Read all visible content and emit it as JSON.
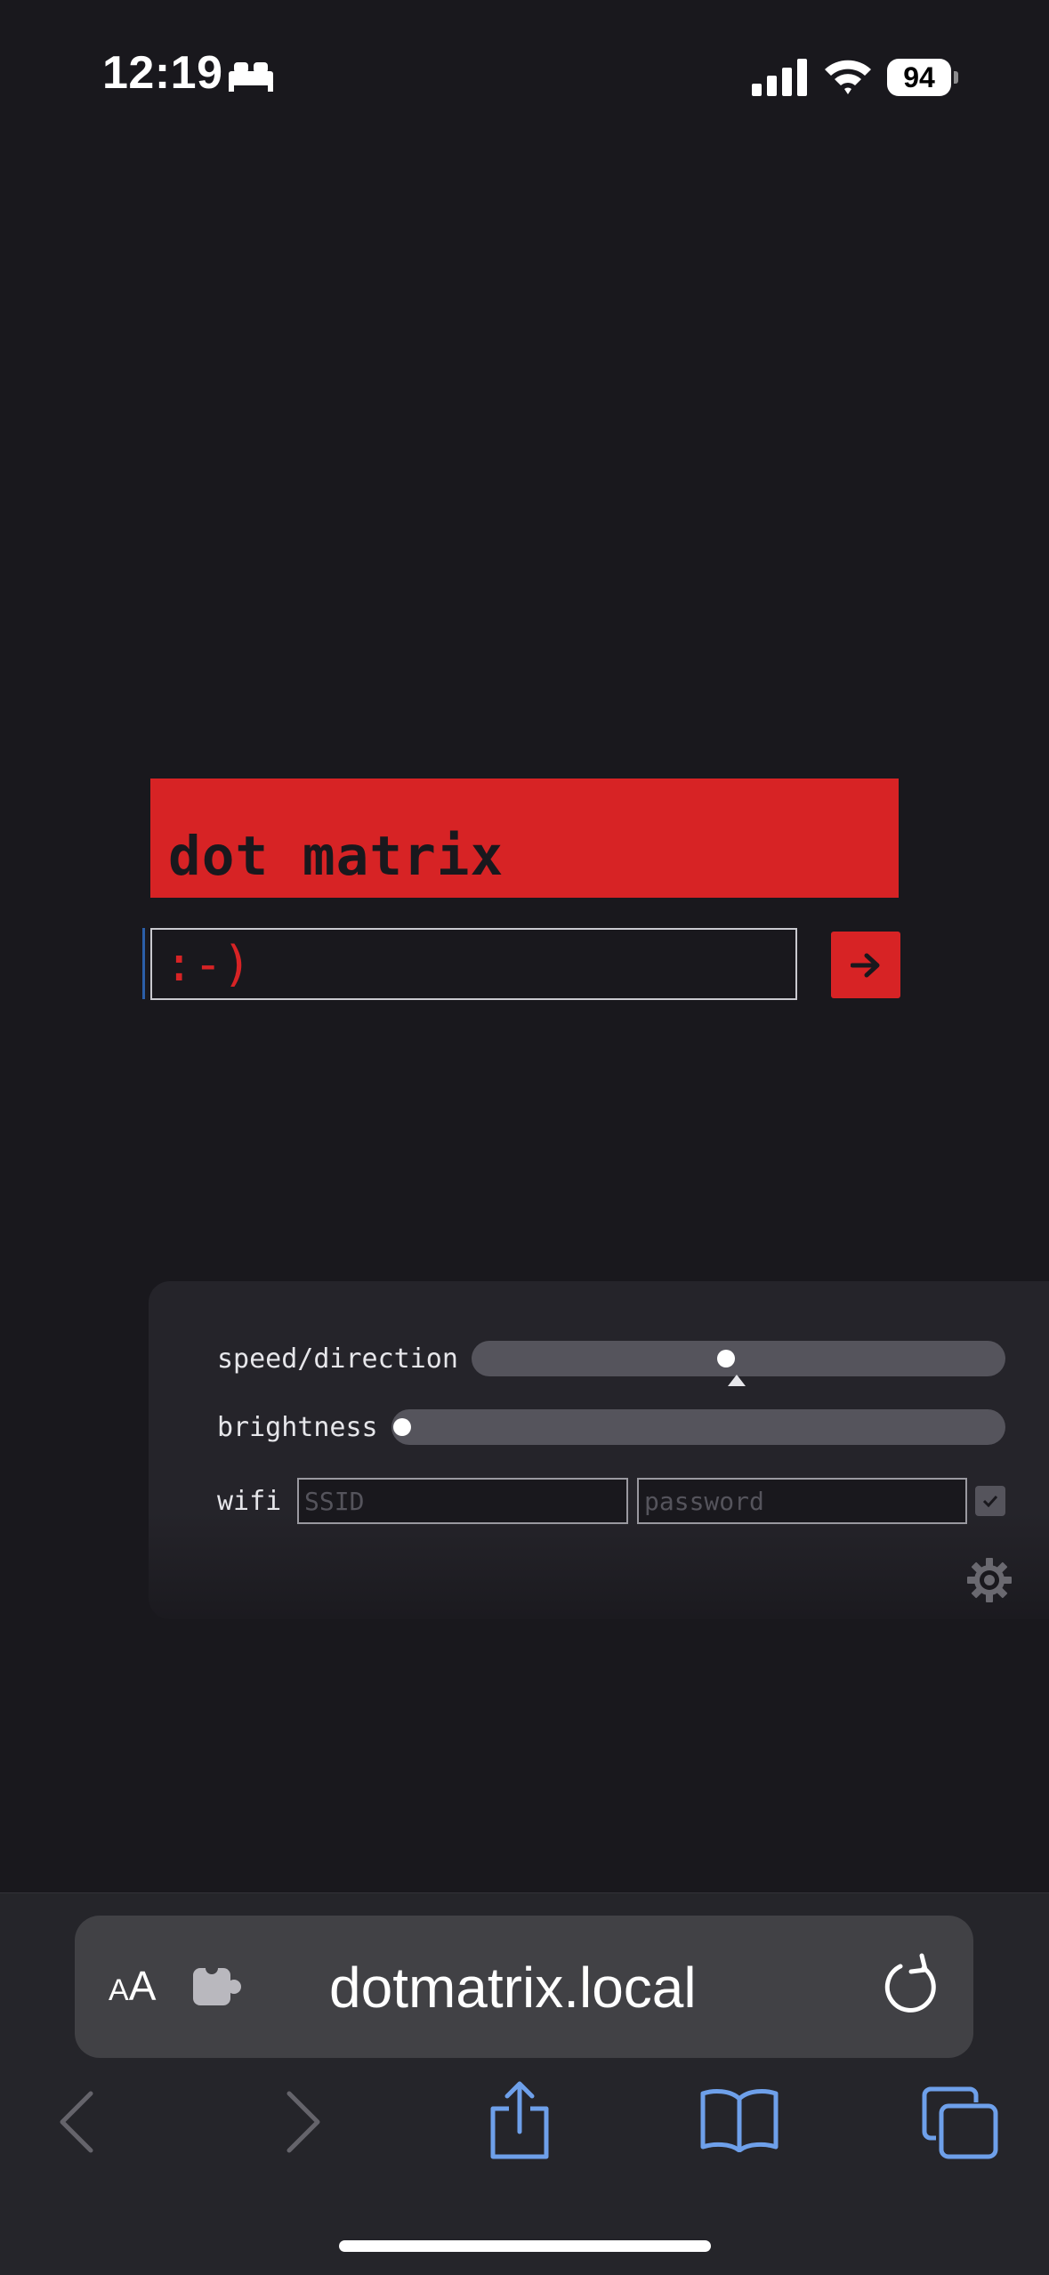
{
  "status_bar": {
    "time": "12:19",
    "battery_level": "94"
  },
  "banner": {
    "text": "dot matrix"
  },
  "message": {
    "value": ":-)"
  },
  "settings": {
    "speed_label": "speed/direction",
    "brightness_label": "brightness",
    "wifi_label": "wifi",
    "ssid_placeholder": "SSID",
    "password_placeholder": "password"
  },
  "browser": {
    "aa_label_small": "A",
    "aa_label_large": "A",
    "url": "dotmatrix.local"
  },
  "colors": {
    "background": "#19181d",
    "accent_red": "#d72325",
    "panel": "#25242a",
    "toolbar": "#25252a",
    "browser_blue": "#6ea0ea"
  }
}
